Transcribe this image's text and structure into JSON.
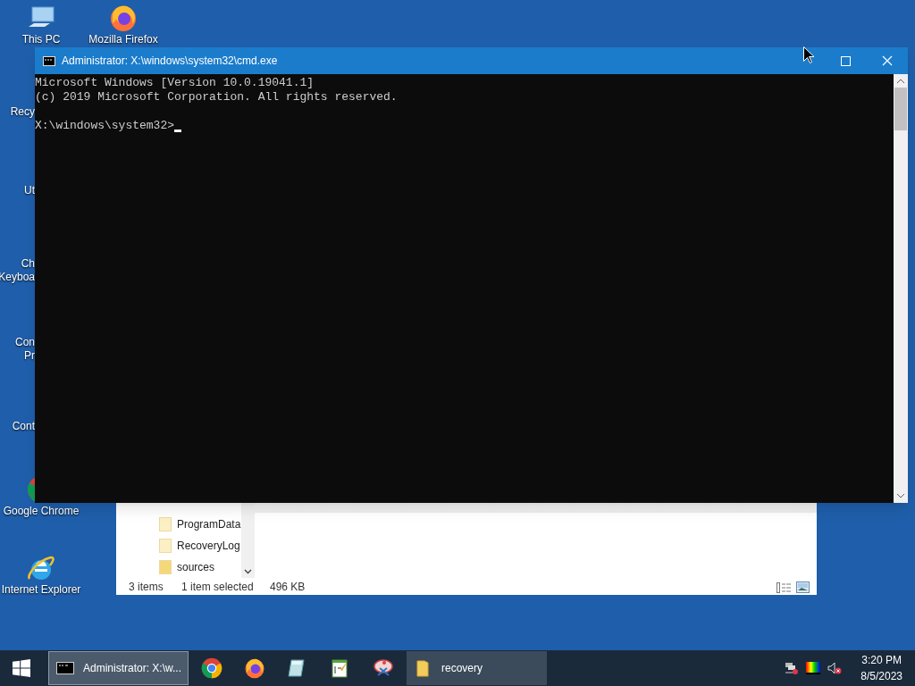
{
  "desktop_icons": [
    {
      "kind": "pc",
      "lines": [
        "This PC"
      ]
    },
    {
      "kind": "firefox",
      "lines": [
        "Mozilla Firefox"
      ]
    },
    {
      "kind": "covered",
      "lines": [
        "Recy"
      ]
    },
    {
      "kind": "covered",
      "lines": [
        "Ut"
      ]
    },
    {
      "kind": "covered",
      "lines": [
        "Ch",
        "Keyboa"
      ]
    },
    {
      "kind": "covered",
      "lines": [
        "Con",
        "Pr"
      ]
    },
    {
      "kind": "covered",
      "lines": [
        "Cont"
      ]
    },
    {
      "kind": "chrome",
      "lines": [
        "Google Chrome"
      ]
    },
    {
      "kind": "ie",
      "lines": [
        "Internet Explorer"
      ]
    }
  ],
  "console_window": {
    "title": "Administrator: X:\\windows\\system32\\cmd.exe",
    "lines": [
      "Microsoft Windows [Version 10.0.19041.1]",
      "(c) 2019 Microsoft Corporation. All rights reserved."
    ],
    "prompt": "X:\\windows\\system32>"
  },
  "explorer_window": {
    "items": [
      {
        "label": "ProgramData"
      },
      {
        "label": "RecoveryLog"
      },
      {
        "label": "sources"
      }
    ],
    "status": [
      "3 items",
      "1 item selected",
      "496 KB"
    ]
  },
  "taskbar": {
    "items": [
      {
        "kind": "console_window",
        "label": "Administrator: X:\\w...",
        "selected": true
      },
      {
        "kind": "chrome"
      },
      {
        "kind": "firefox"
      },
      {
        "kind": "notepad"
      },
      {
        "kind": "editor"
      },
      {
        "kind": "paint"
      },
      {
        "kind": "folder_window",
        "label": "recovery",
        "selected": false
      }
    ],
    "time": "3:20 PM",
    "date": "8/5/2023"
  }
}
